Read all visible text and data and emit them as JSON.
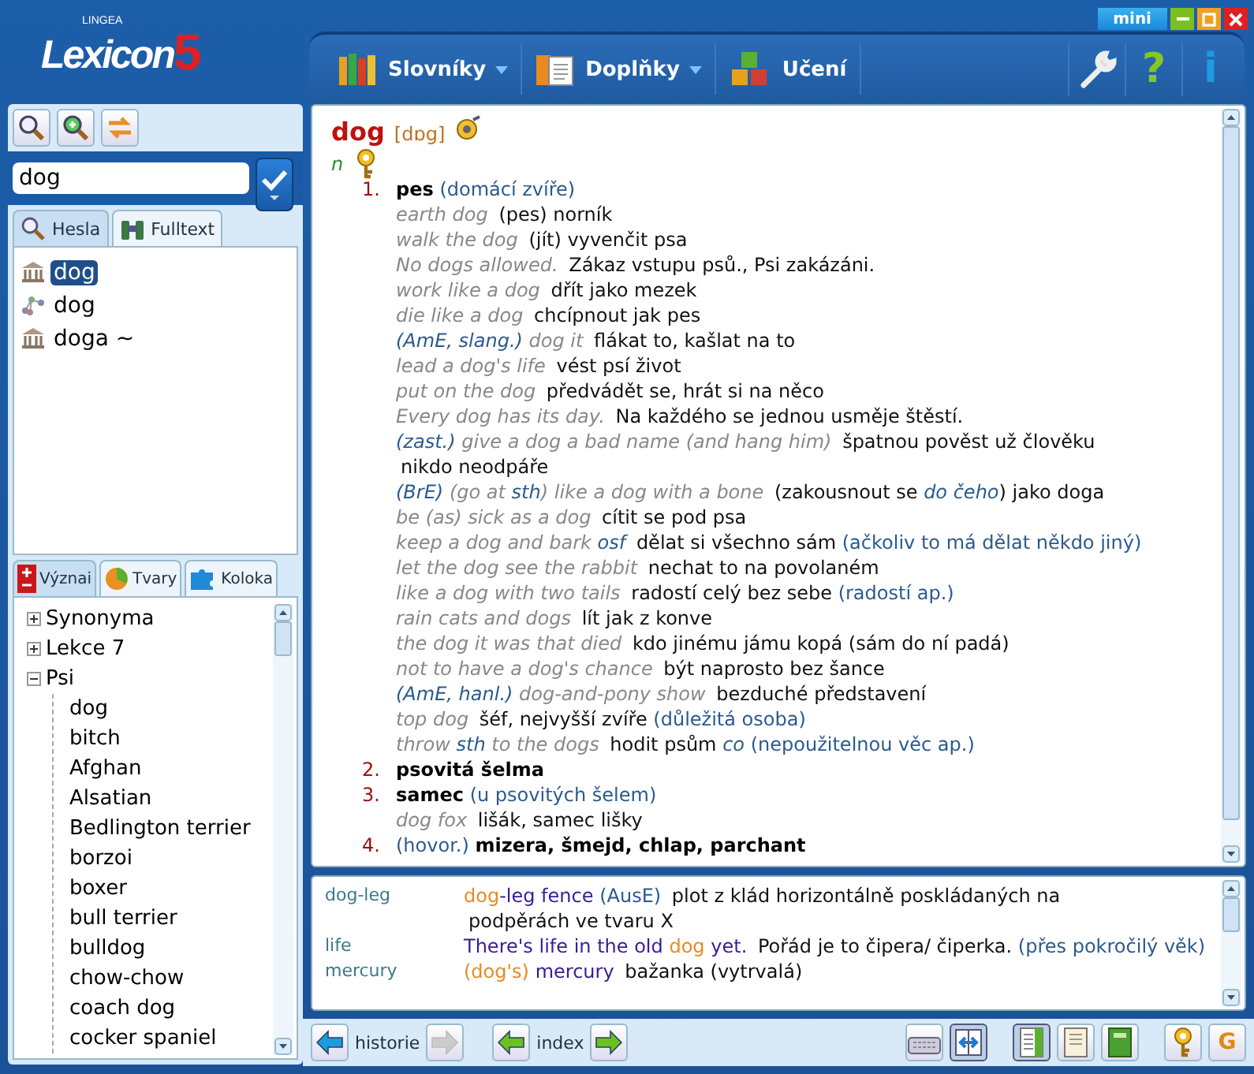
{
  "window": {
    "logo": {
      "brand": "LINGEA",
      "name": "Lexicon",
      "version": "5"
    },
    "mini_button": "mini"
  },
  "menu": [
    {
      "label": "Slovníky",
      "dropdown": true
    },
    {
      "label": "Doplňky",
      "dropdown": true
    },
    {
      "label": "Učení",
      "dropdown": false
    }
  ],
  "tools": [
    {
      "kind": "wrench"
    },
    {
      "kind": "glyph",
      "text": "?",
      "color": "#86c81e"
    },
    {
      "kind": "glyph",
      "text": "i",
      "color": "#1e9be0"
    }
  ],
  "search": {
    "value": "dog"
  },
  "search_tabs": [
    {
      "label": "Hesla",
      "selected": true
    },
    {
      "label": "Fulltext",
      "selected": false
    }
  ],
  "results": [
    {
      "text": "dog",
      "kind": "entry",
      "selected": true
    },
    {
      "text": "dog",
      "kind": "phrase",
      "selected": false
    },
    {
      "text": "doga ~",
      "kind": "entry",
      "selected": false
    }
  ],
  "info_tabs": [
    {
      "label": "Význai",
      "selected": true
    },
    {
      "label": "Tvary",
      "selected": false
    },
    {
      "label": "Koloka",
      "selected": false
    }
  ],
  "tree": [
    {
      "label": "Synonyma",
      "expanded": false
    },
    {
      "label": "Lekce 7",
      "expanded": false
    },
    {
      "label": "Psi",
      "expanded": true,
      "children": [
        {
          "label": "dog"
        },
        {
          "label": "bitch"
        },
        {
          "label": "Afghan"
        },
        {
          "label": "Alsatian"
        },
        {
          "label": "Bedlington terrier"
        },
        {
          "label": "borzoi"
        },
        {
          "label": "boxer"
        },
        {
          "label": "bull terrier"
        },
        {
          "label": "bulldog"
        },
        {
          "label": "chow-chow"
        },
        {
          "label": "coach dog"
        },
        {
          "label": "cocker spaniel"
        }
      ]
    }
  ],
  "entry": {
    "headword": "dog",
    "pronunciation": "[dɒg]",
    "pos": "n",
    "senses": [
      {
        "number": "1.",
        "lines": [
          [
            {
              "text": "pes",
              "kind": "def"
            },
            {
              "text": "(domácí zvíře)",
              "kind": "note"
            }
          ],
          [
            {
              "text": "earth dog",
              "kind": "phrase"
            },
            {
              "text": "(pes) norník",
              "kind": "trans"
            }
          ],
          [
            {
              "text": "walk the dog",
              "kind": "phrase"
            },
            {
              "text": "(jít) vyvenčit psa",
              "kind": "trans"
            }
          ],
          [
            {
              "text": "No dogs allowed.",
              "kind": "phrase"
            },
            {
              "text": "Zákaz vstupu psů., Psi zakázáni.",
              "kind": "trans"
            }
          ],
          [
            {
              "text": "work like a dog",
              "kind": "phrase"
            },
            {
              "text": "dřít jako mezek",
              "kind": "trans"
            }
          ],
          [
            {
              "text": "die like a dog",
              "kind": "phrase"
            },
            {
              "text": "chcípnout jak pes",
              "kind": "trans"
            }
          ],
          [
            {
              "text": "(AmE, slang.)",
              "kind": "label"
            },
            {
              "text": "dog it",
              "kind": "phrase"
            },
            {
              "text": "flákat to, kašlat na to",
              "kind": "trans"
            }
          ],
          [
            {
              "text": "lead a dog's life",
              "kind": "phrase"
            },
            {
              "text": "vést psí život",
              "kind": "trans"
            }
          ],
          [
            {
              "text": "put on the dog",
              "kind": "phrase"
            },
            {
              "text": "předvádět se, hrát si na něco",
              "kind": "trans"
            }
          ],
          [
            {
              "text": "Every dog has its day.",
              "kind": "phrase"
            },
            {
              "text": "Na každého se jednou usměje štěstí.",
              "kind": "trans"
            }
          ],
          [
            {
              "text": "(zast.)",
              "kind": "label"
            },
            {
              "text": "give a dog a bad name (and hang him)",
              "kind": "phrase"
            },
            {
              "text": "špatnou pověst už člověku",
              "kind": "trans"
            },
            {
              "text": "nikdo neodpáře",
              "kind": "trans"
            }
          ],
          [
            {
              "text": "(BrE)",
              "kind": "label"
            },
            {
              "text": "(go at",
              "kind": "phrase"
            },
            {
              "text": "sth",
              "kind": "obj"
            },
            {
              "text": ")",
              "kind": "phrase",
              "joined": true
            },
            {
              "text": "like a dog with a bone",
              "kind": "phrase"
            },
            {
              "text": "(zakousnout se",
              "kind": "trans"
            },
            {
              "text": "do čeho",
              "kind": "obj"
            },
            {
              "text": ") jako doga",
              "kind": "trans",
              "joined": true
            }
          ],
          [
            {
              "text": "be (as) sick as a dog",
              "kind": "phrase"
            },
            {
              "text": "cítit se pod psa",
              "kind": "trans"
            }
          ],
          [
            {
              "text": "keep a dog and bark",
              "kind": "phrase"
            },
            {
              "text": "osf",
              "kind": "obj"
            },
            {
              "text": "dělat si všechno sám",
              "kind": "trans"
            },
            {
              "text": "(ačkoliv to má dělat někdo jiný)",
              "kind": "note"
            }
          ],
          [
            {
              "text": "let the dog see the rabbit",
              "kind": "phrase"
            },
            {
              "text": "nechat to na povolaném",
              "kind": "trans"
            }
          ],
          [
            {
              "text": "like a dog with two tails",
              "kind": "phrase"
            },
            {
              "text": "radostí celý bez sebe",
              "kind": "trans"
            },
            {
              "text": "(radostí ap.)",
              "kind": "note"
            }
          ],
          [
            {
              "text": "rain cats and dogs",
              "kind": "phrase"
            },
            {
              "text": "lít jak z konve",
              "kind": "trans"
            }
          ],
          [
            {
              "text": "the dog it was that died",
              "kind": "phrase"
            },
            {
              "text": "kdo jinému jámu kopá (sám do ní padá)",
              "kind": "trans"
            }
          ],
          [
            {
              "text": "not to have a dog's chance",
              "kind": "phrase"
            },
            {
              "text": "být naprosto bez šance",
              "kind": "trans"
            }
          ],
          [
            {
              "text": "(AmE, hanl.)",
              "kind": "label"
            },
            {
              "text": "dog-and-pony show",
              "kind": "phrase"
            },
            {
              "text": "bezduché představení",
              "kind": "trans"
            }
          ],
          [
            {
              "text": "top dog",
              "kind": "phrase"
            },
            {
              "text": "šéf, nejvyšší zvíře",
              "kind": "trans"
            },
            {
              "text": "(důležitá osoba)",
              "kind": "note"
            }
          ],
          [
            {
              "text": "throw",
              "kind": "phrase"
            },
            {
              "text": "sth",
              "kind": "obj"
            },
            {
              "text": "to the dogs",
              "kind": "phrase"
            },
            {
              "text": "hodit psům",
              "kind": "trans"
            },
            {
              "text": "co",
              "kind": "obj"
            },
            {
              "text": "(nepoužitelnou věc ap.)",
              "kind": "note"
            }
          ]
        ]
      },
      {
        "number": "2.",
        "lines": [
          [
            {
              "text": "psovitá šelma",
              "kind": "def"
            }
          ]
        ]
      },
      {
        "number": "3.",
        "lines": [
          [
            {
              "text": "samec",
              "kind": "def"
            },
            {
              "text": "(u psovitých šelem)",
              "kind": "note"
            }
          ],
          [
            {
              "text": "dog fox",
              "kind": "phrase"
            },
            {
              "text": "lišák, samec lišky",
              "kind": "trans"
            }
          ]
        ]
      },
      {
        "number": "4.",
        "lines": [
          [
            {
              "text": "(hovor.)",
              "kind": "note"
            },
            {
              "text": "mizera, šmejd, chlap, parchant",
              "kind": "def"
            }
          ]
        ]
      }
    ]
  },
  "related": [
    {
      "keyword": "dog-leg",
      "segments": [
        {
          "text": "dog",
          "kind": "match"
        },
        {
          "text": "-leg fence",
          "kind": "source",
          "joined": true
        },
        {
          "text": "(AusE)",
          "kind": "note"
        },
        {
          "text": "plot z klád horizontálně poskládaných na",
          "kind": "trans"
        },
        {
          "text": "podpěrách ve tvaru X",
          "kind": "trans"
        }
      ]
    },
    {
      "keyword": "life",
      "segments": [
        {
          "text": "There's life in the old",
          "kind": "source"
        },
        {
          "text": "dog",
          "kind": "match"
        },
        {
          "text": "yet.",
          "kind": "source"
        },
        {
          "text": "Pořád je to čipera/ čiperka.",
          "kind": "trans"
        },
        {
          "text": "(přes",
          "kind": "note"
        },
        {
          "text": "pokročilý věk)",
          "kind": "note"
        }
      ]
    },
    {
      "keyword": "mercury",
      "segments": [
        {
          "text": "(dog's)",
          "kind": "match"
        },
        {
          "text": "mercury",
          "kind": "source"
        },
        {
          "text": "bažanka (vytrvalá)",
          "kind": "trans"
        }
      ]
    }
  ],
  "bottom_bar": {
    "history": {
      "label": "historie",
      "back_disabled": false,
      "forward_disabled": true
    },
    "index": {
      "label": "index"
    },
    "tools": [
      {
        "kind": "icon",
        "pressed": false
      },
      {
        "kind": "icon",
        "pressed": true
      },
      {
        "kind": "icon",
        "pressed": true
      },
      {
        "kind": "icon",
        "pressed": false
      },
      {
        "kind": "icon",
        "pressed": false
      },
      {
        "kind": "icon",
        "pressed": false
      },
      {
        "kind": "glyph",
        "text": "G",
        "pressed": false
      }
    ]
  }
}
